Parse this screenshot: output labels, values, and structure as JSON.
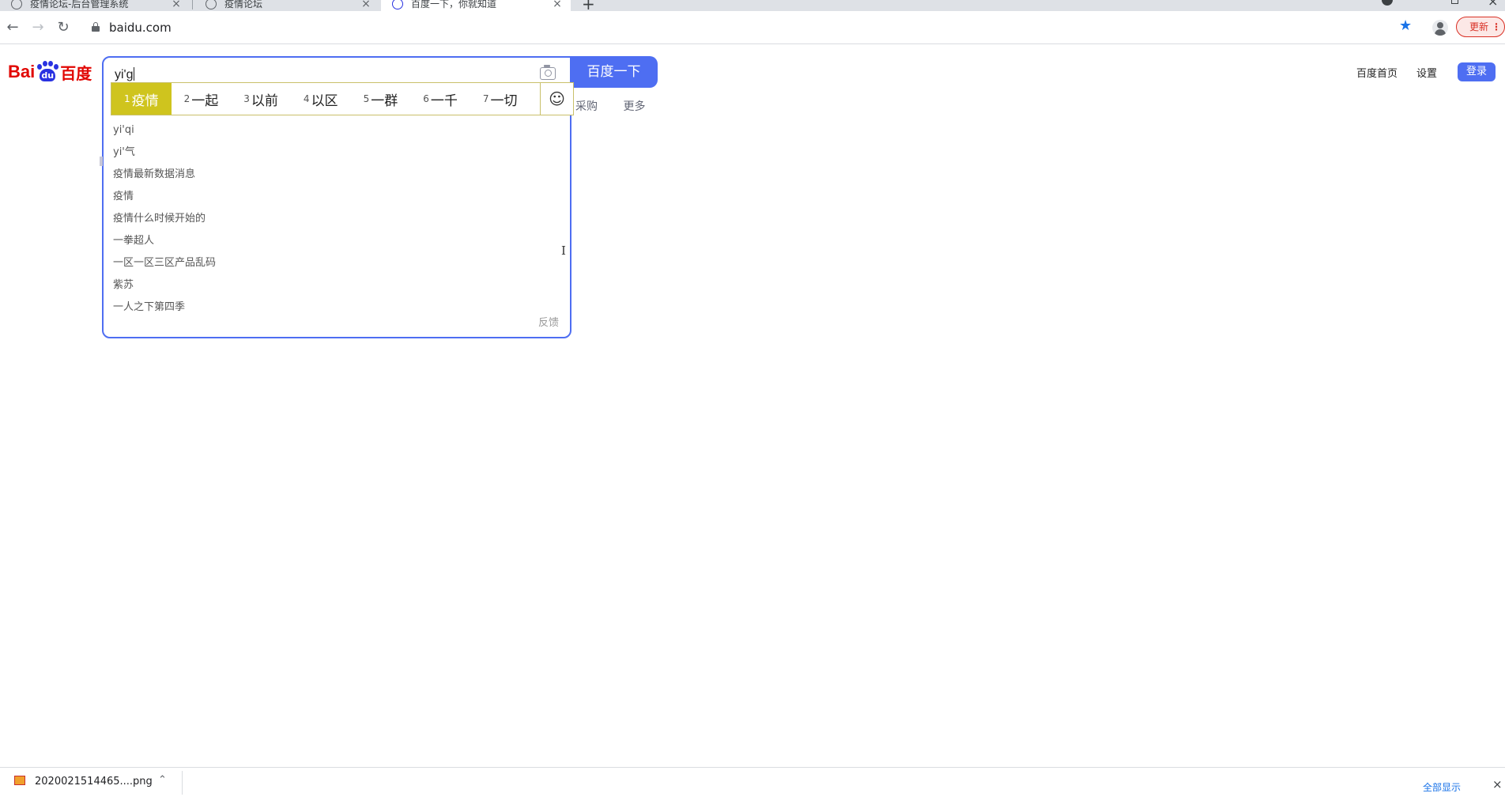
{
  "browser": {
    "tabs": [
      {
        "title": "疫情论坛-后台管理系统",
        "active": false
      },
      {
        "title": "疫情论坛",
        "active": false
      },
      {
        "title": "百度一下，你就知道",
        "active": true
      }
    ],
    "new_tab_label": "+",
    "url": "baidu.com",
    "update_label": "更新",
    "update_menu_glyph": "⋮"
  },
  "page": {
    "logo": {
      "latin": "Bai",
      "paw_text": "du",
      "cn": "百度"
    },
    "search": {
      "value": "yi'g",
      "button_label": "百度一下"
    },
    "ime": {
      "candidates": [
        {
          "num": "1",
          "text": "疫情"
        },
        {
          "num": "2",
          "text": "一起"
        },
        {
          "num": "3",
          "text": "以前"
        },
        {
          "num": "4",
          "text": "以区"
        },
        {
          "num": "5",
          "text": "一群"
        },
        {
          "num": "6",
          "text": "一千"
        },
        {
          "num": "7",
          "text": "一切"
        }
      ],
      "selected_index": 0,
      "emoji_glyph": "☺"
    },
    "suggestions": [
      "yi'qi",
      "yi'气",
      "疫情最新数据消息",
      "疫情",
      "疫情什么时候开始的",
      "一拳超人",
      "一区一区三区产品乱码",
      "紫苏",
      "一人之下第四季"
    ],
    "feedback_label": "反馈",
    "nav_partial": [
      "采购",
      "更多"
    ],
    "top_right": {
      "home_label": "百度首页",
      "settings_label": "设置",
      "login_label": "登录"
    }
  },
  "download_shelf": {
    "file_name": "2020021514465....png",
    "show_all_label": "全部显示"
  },
  "colors": {
    "baidu_blue": "#4e6ef2",
    "baidu_red": "#e10602",
    "ime_selected": "#cfc41e",
    "chrome_blue": "#1a73e8"
  }
}
